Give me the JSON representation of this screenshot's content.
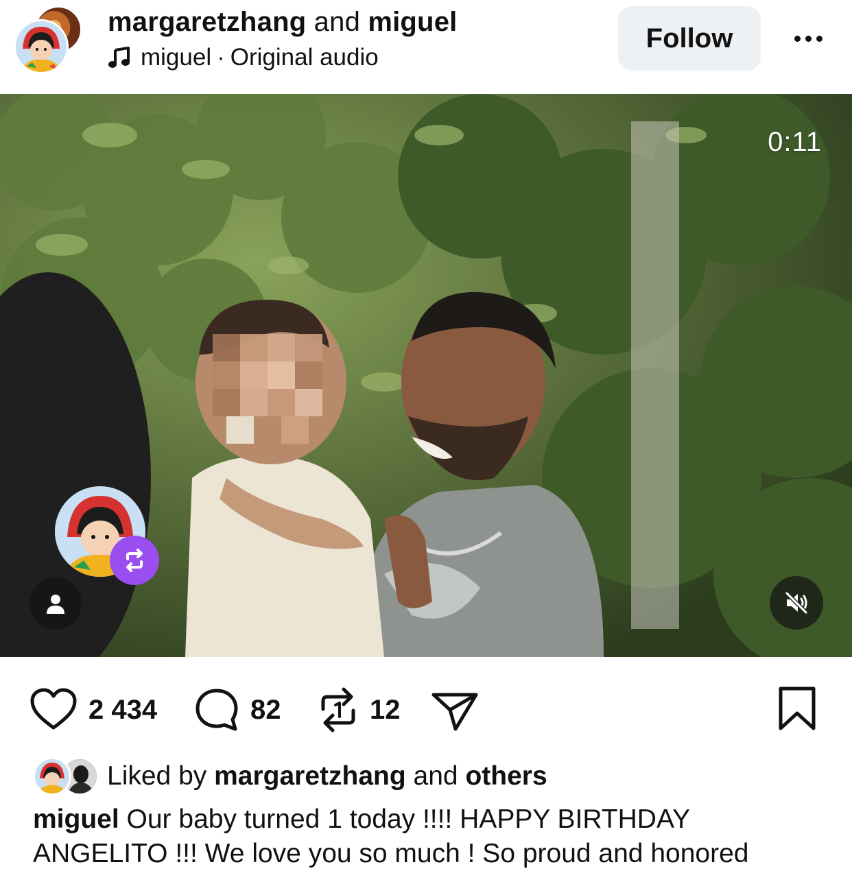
{
  "header": {
    "user1": "margaretzhang",
    "and_text": "and",
    "user2": "miguel",
    "audio_artist": "miguel",
    "audio_separator": "·",
    "audio_title": "Original audio",
    "follow_label": "Follow",
    "more_icon": "more-horizontal-icon"
  },
  "video": {
    "timer": "0:11",
    "muted": true
  },
  "actions": {
    "likes_count": "2 434",
    "comments_count": "82",
    "reposts_count": "12"
  },
  "liked_by": {
    "prefix": "Liked by",
    "user": "margaretzhang",
    "and_text": "and",
    "others": "others"
  },
  "caption": {
    "username": "miguel",
    "text": "Our baby turned 1 today !!!! HAPPY BIRTHDAY",
    "text_cont": "ANGELITO !!! We love you so much ! So proud and honored"
  },
  "colors": {
    "follow_bg": "#eef1f4",
    "repost_badge": "#9b4ef0",
    "text": "#111111"
  }
}
